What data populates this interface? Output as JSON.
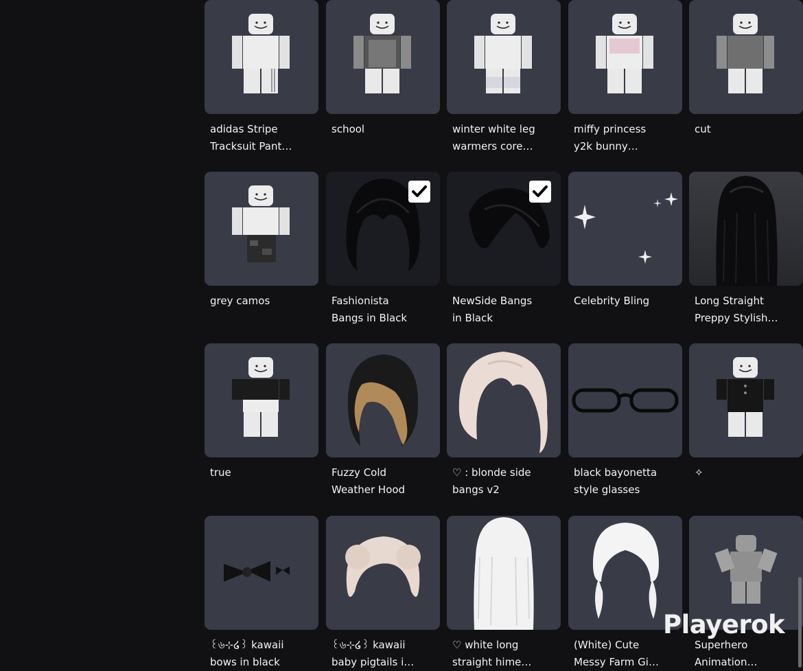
{
  "grid": {
    "items": [
      {
        "name": "adidas Stripe\nTracksuit Pant…",
        "icon": "avatar-outfit-icon",
        "selected": false
      },
      {
        "name": "school",
        "icon": "avatar-outfit-icon",
        "selected": false
      },
      {
        "name": "winter white leg\nwarmers core…",
        "icon": "avatar-outfit-icon",
        "selected": false
      },
      {
        "name": "miffy princess\ny2k bunny…",
        "icon": "avatar-outfit-icon",
        "selected": false
      },
      {
        "name": "cut",
        "icon": "avatar-outfit-icon",
        "selected": false
      },
      {
        "name": "grey camos",
        "icon": "avatar-outfit-icon",
        "selected": false
      },
      {
        "name": "Fashionista\nBangs in Black",
        "icon": "black-bangs-icon",
        "selected": true
      },
      {
        "name": "NewSide Bangs\nin Black",
        "icon": "black-side-bangs-icon",
        "selected": true
      },
      {
        "name": "Celebrity Bling",
        "icon": "sparkles-icon",
        "selected": false
      },
      {
        "name": "Long Straight\nPreppy Stylish…",
        "icon": "long-black-hair-icon",
        "selected": false
      },
      {
        "name": "true",
        "icon": "avatar-outfit-icon",
        "selected": false
      },
      {
        "name": "Fuzzy Cold\nWeather Hood",
        "icon": "fur-hood-icon",
        "selected": false
      },
      {
        "name": "♡ : blonde side\nbangs v2",
        "icon": "blonde-bangs-icon",
        "selected": false
      },
      {
        "name": "black bayonetta\nstyle glasses",
        "icon": "glasses-icon",
        "selected": false
      },
      {
        "name": "✧",
        "icon": "avatar-outfit-icon",
        "selected": false
      },
      {
        "name": "꒰৬⊹໒꒱ kawaii\nbows in black",
        "icon": "black-bows-icon",
        "selected": false
      },
      {
        "name": "꒰৬⊹໒꒱ kawaii\nbaby pigtails i…",
        "icon": "blonde-buns-icon",
        "selected": false
      },
      {
        "name": "♡ white long\nstraight hime…",
        "icon": "white-long-hair-icon",
        "selected": false
      },
      {
        "name": "(White) Cute\nMessy Farm Gi…",
        "icon": "white-pigtails-icon",
        "selected": false
      },
      {
        "name": "Superhero\nAnimation…",
        "icon": "animation-pose-icon",
        "selected": false
      }
    ]
  },
  "watermark": "Playerok",
  "colors": {
    "tile": "#393b47",
    "page": "#111114",
    "text": "#f3f3f3"
  }
}
